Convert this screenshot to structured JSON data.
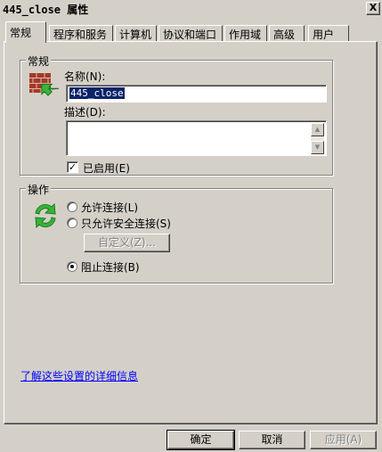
{
  "window": {
    "title": "445_close 属性",
    "close_label": "X"
  },
  "tabs": [
    {
      "label": "常规"
    },
    {
      "label": "程序和服务"
    },
    {
      "label": "计算机"
    },
    {
      "label": "协议和端口"
    },
    {
      "label": "作用域"
    },
    {
      "label": "高级"
    },
    {
      "label": "用户"
    }
  ],
  "general_group": {
    "title": "常规",
    "icon": "firewall-rule-icon",
    "name_label": "名称(N):",
    "name_value": "445_close",
    "desc_label": "描述(D):",
    "desc_value": "",
    "enabled_label": "已启用(E)",
    "enabled": true
  },
  "action_group": {
    "title": "操作",
    "icon": "green-arrows-icon",
    "options": [
      {
        "label": "允许连接(L)",
        "checked": false
      },
      {
        "label": "只允许安全连接(S)",
        "checked": false
      },
      {
        "label": "阻止连接(B)",
        "checked": true
      }
    ],
    "customize_label": "自定义(Z)..."
  },
  "learn_more_link": "了解这些设置的详细信息",
  "buttons": {
    "ok": "确定",
    "cancel": "取消",
    "apply": "应用(A)"
  },
  "colors": {
    "face": "#d4d0c8",
    "selection": "#0a246a",
    "link": "#0000ff"
  }
}
